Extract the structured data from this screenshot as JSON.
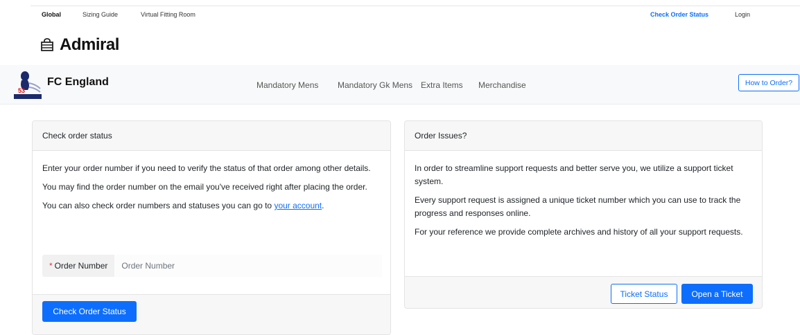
{
  "topnav": {
    "global": "Global",
    "sizing_guide": "Sizing Guide",
    "virtual_fitting_room": "Virtual Fitting Room",
    "check_order_status": "Check Order Status",
    "login": "Login"
  },
  "brand": {
    "name": "Admiral"
  },
  "club": {
    "name": "FC England",
    "nav": [
      "Mandatory Mens",
      "Mandatory Gk Mens",
      "Extra Items",
      "Merchandise"
    ],
    "how_to_order": "How to Order?"
  },
  "check_status": {
    "title": "Check order status",
    "p1": "Enter your order number if you need to verify the status of that order among other details.",
    "p2": "You may find the order number on the email you've received right after placing the order.",
    "p3_prefix": "You can also check order numbers and statuses you can go to ",
    "p3_link": "your account",
    "p3_suffix": ".",
    "order_label": "Order Number",
    "order_required": "*",
    "order_placeholder": "Order Number",
    "button": "Check Order Status"
  },
  "issues": {
    "title": "Order Issues?",
    "p1": "In order to streamline support requests and better serve you, we utilize a support ticket system.",
    "p2": "Every support request is assigned a unique ticket number which you can use to track the progress and responses online.",
    "p3": "For your reference we provide complete archives and history of all your support requests.",
    "ticket_status": "Ticket Status",
    "open_ticket": "Open a Ticket"
  },
  "colors": {
    "primary": "#0d6efd",
    "required": "#dc3545"
  }
}
